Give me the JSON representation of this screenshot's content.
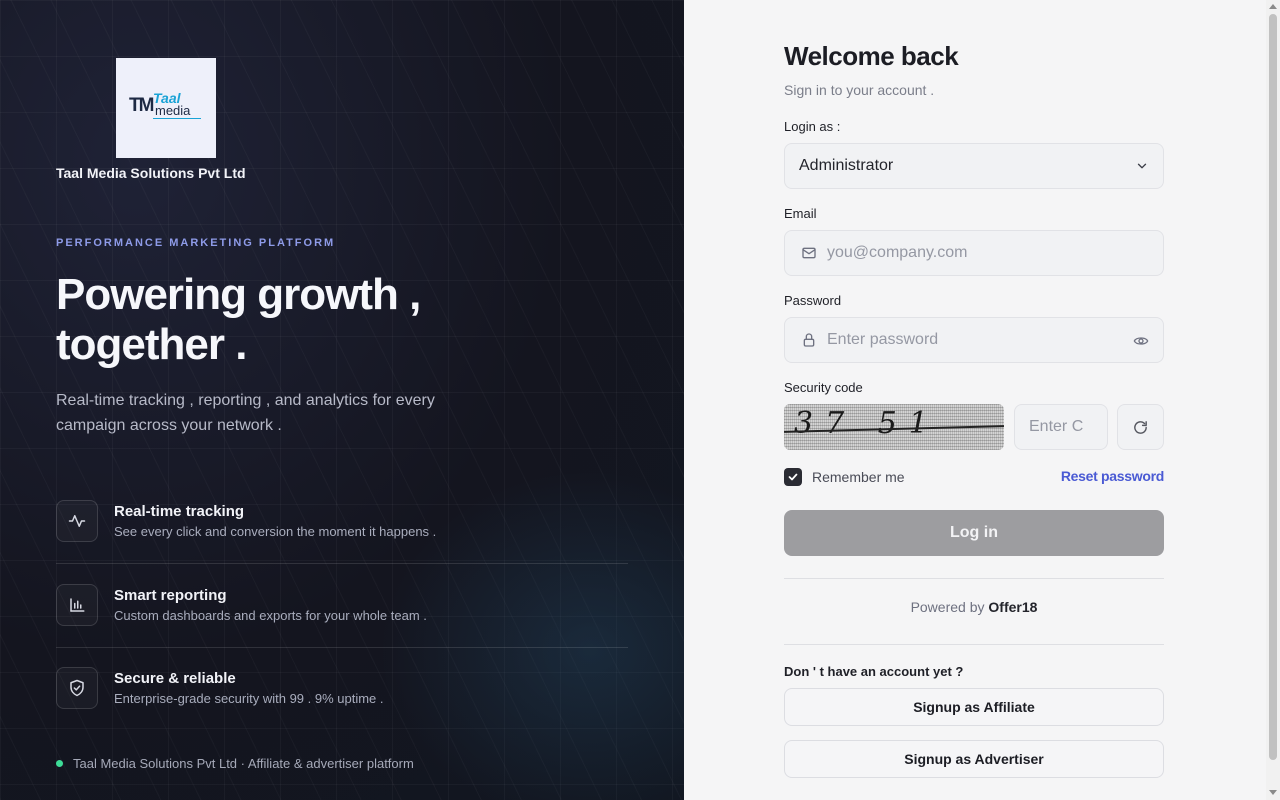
{
  "brand": {
    "company_name": "Taal Media Solutions Pvt Ltd",
    "logo_text_top": "Taal",
    "logo_text_bottom": "media",
    "logo_mark": "TM",
    "eyebrow": "PERFORMANCE MARKETING PLATFORM",
    "headline_line1": "Powering growth ,",
    "headline_line2": "together .",
    "lede": "Real-time tracking , reporting , and analytics for every campaign across your network ."
  },
  "features": [
    {
      "icon": "activity-icon",
      "title": "Real-time tracking",
      "desc": "See every click and conversion the moment it happens ."
    },
    {
      "icon": "bar-chart-icon",
      "title": "Smart reporting",
      "desc": "Custom dashboards and exports for your whole team ."
    },
    {
      "icon": "shield-check-icon",
      "title": "Secure & reliable",
      "desc": "Enterprise-grade security with 99 . 9% uptime ."
    }
  ],
  "footer_left": "Taal Media Solutions Pvt Ltd · Affiliate & advertiser platform",
  "form": {
    "title": "Welcome back",
    "subtitle": "Sign in to your account .",
    "login_as_label": "Login as :",
    "login_as_value": "Administrator",
    "email_label": "Email",
    "email_placeholder": "you@company.com",
    "password_label": "Password",
    "password_placeholder": "Enter password",
    "security_label": "Security code",
    "captcha_text": "37 51",
    "code_placeholder": "Enter C",
    "remember_label": "Remember me",
    "remember_checked": true,
    "reset_label": "Reset password",
    "login_label": "Log in",
    "powered_prefix": "Powered by",
    "powered_brand": "Offer18",
    "no_account": "Don ' t have an account yet ?",
    "signup_affiliate": "Signup as Affiliate",
    "signup_advertiser": "Signup as Advertiser"
  },
  "colors": {
    "left_bg": "#14151f",
    "eyebrow": "#8e9be8",
    "accent_link": "#4a5ad4",
    "status_dot": "#3ddc97",
    "login_btn": "#9d9da0"
  }
}
